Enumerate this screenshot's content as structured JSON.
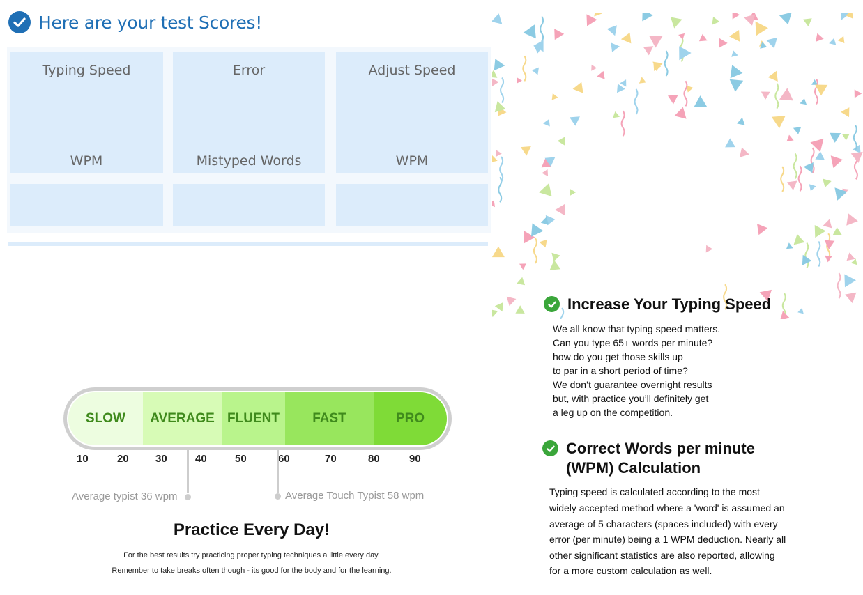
{
  "header": {
    "title": "Here are your test Scores!",
    "icon": "check-circle-icon"
  },
  "scores": {
    "cards": [
      {
        "title": "Typing Speed",
        "unit": "WPM",
        "value": ""
      },
      {
        "title": "Error",
        "unit": "Mistyped Words",
        "value": ""
      },
      {
        "title": "Adjust Speed",
        "unit": "WPM",
        "value": ""
      }
    ]
  },
  "scale": {
    "segments": [
      "SLOW",
      "AVERAGE",
      "FLUENT",
      "FAST",
      "PRO"
    ],
    "ticks": [
      "10",
      "20",
      "30",
      "40",
      "50",
      "60",
      "70",
      "80",
      "90"
    ],
    "markers": [
      {
        "label": "Average typist 36 wpm",
        "wpm": 36
      },
      {
        "label": "Average Touch Typist 58 wpm",
        "wpm": 58
      }
    ]
  },
  "practice": {
    "title": "Practice Every Day!",
    "lines": [
      "For the best results try practicing proper typing techniques a little every day.",
      "Remember to take breaks often though - its good for the body and for the learning."
    ]
  },
  "increase": {
    "title": "Increase Your Typing Speed",
    "lines": [
      "We all know that typing speed matters.",
      "Can you type 65+ words per minute?",
      "how do you get those skills up",
      "to par in a short period of time?",
      "We don’t guarantee overnight results",
      "but, with practice you’ll definitely get",
      "a leg up on the competition."
    ]
  },
  "wpm": {
    "title_line1": "Correct Words per minute",
    "title_line2": "(WPM) Calculation",
    "lines": [
      "Typing speed is calculated according to the most",
      "widely accepted method where a 'word' is assumed an",
      "average of 5 characters (spaces included) with every",
      "error (per minute) being a 1 WPM deduction. Nearly all",
      "other significant statistics are also reported, allowing",
      "for a more custom calculation as well."
    ]
  },
  "colors": {
    "brand_blue": "#1f6fb5",
    "card_bg": "#dcecfb",
    "check_green": "#3aa63a",
    "scale_slow": "#edfde0",
    "scale_pro": "#7fdb37",
    "segment_text": "#3f8a1c"
  }
}
